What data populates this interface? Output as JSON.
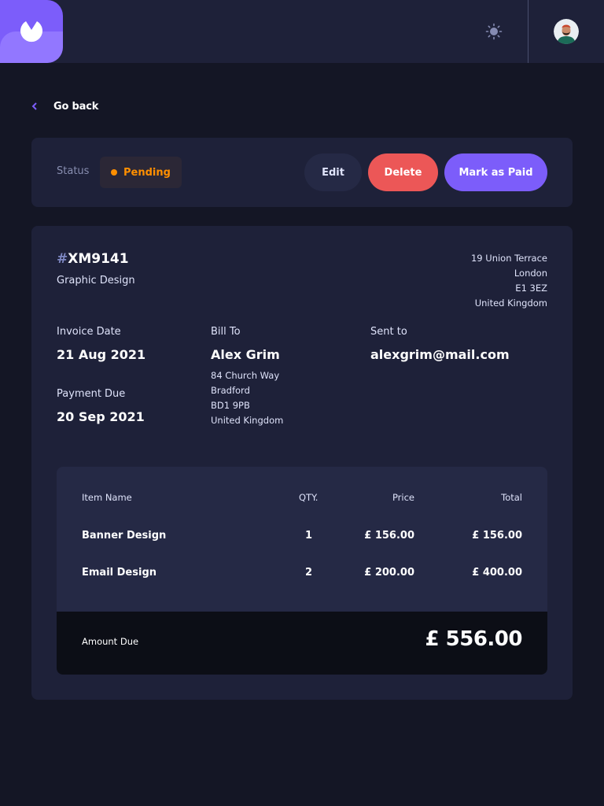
{
  "colors": {
    "background": "#141625",
    "surface": "#1e2139",
    "accent": "#7c5dfa",
    "danger": "#ec5757",
    "pending": "#ff8f00",
    "table_bg": "#252945",
    "amount_bg": "#0c0e16"
  },
  "header": {
    "logo_icon": "app-logo-icon",
    "theme_icon": "sun-icon",
    "avatar_icon": "user-avatar"
  },
  "nav": {
    "back_icon": "chevron-left-icon",
    "back_label": "Go back"
  },
  "status_bar": {
    "label": "Status",
    "status": "Pending",
    "edit_label": "Edit",
    "delete_label": "Delete",
    "mark_paid_label": "Mark as Paid"
  },
  "invoice": {
    "id_prefix": "#",
    "id": "XM9141",
    "description": "Graphic Design",
    "sender_address": {
      "street": "19 Union Terrace",
      "city": "London",
      "post_code": "E1 3EZ",
      "country": "United Kingdom"
    },
    "invoice_date_label": "Invoice Date",
    "invoice_date": "21 Aug 2021",
    "payment_due_label": "Payment Due",
    "payment_due": "20 Sep 2021",
    "bill_to_label": "Bill To",
    "client_name": "Alex Grim",
    "client_address": {
      "street": "84 Church Way",
      "city": "Bradford",
      "post_code": "BD1 9PB",
      "country": "United Kingdom"
    },
    "sent_to_label": "Sent to",
    "client_email": "alexgrim@mail.com"
  },
  "items_table": {
    "headers": {
      "name": "Item Name",
      "qty": "QTY.",
      "price": "Price",
      "total": "Total"
    },
    "rows": [
      {
        "name": "Banner Design",
        "qty": "1",
        "price": "£ 156.00",
        "total": "£ 156.00"
      },
      {
        "name": "Email Design",
        "qty": "2",
        "price": "£ 200.00",
        "total": "£ 400.00"
      }
    ],
    "amount_due_label": "Amount Due",
    "amount_due": "£ 556.00"
  }
}
